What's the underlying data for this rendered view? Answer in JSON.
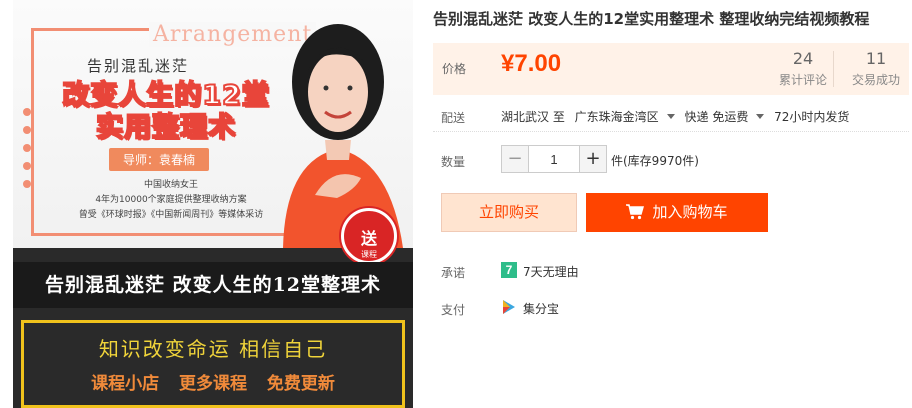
{
  "product_image": {
    "watermark": "Arrangement",
    "chaos_line": "告别混乱迷茫",
    "headline_1": "改变人生的12堂",
    "headline_2": "实用整理术",
    "teacher": "导师：袁春楠",
    "tag_1": "中国收纳女王",
    "tag_2": "4年为10000个家庭提供整理收纳方案",
    "tag_3": "曾受《环球时报》《中国新闻周刊》等媒体采访",
    "gift_main": "送",
    "gift_sub": "课程",
    "banner": "告别混乱迷茫  改变人生的12堂整理术",
    "slogan": "知识改变命运   相信自己",
    "tags": [
      "课程小店",
      "更多课程",
      "免费更新"
    ]
  },
  "product": {
    "title": "告别混乱迷茫 改变人生的12堂实用整理术 整理收纳完结视频教程",
    "price_label": "价格",
    "price": "¥7.00",
    "reviews_count": "24",
    "reviews_label": "累计评论",
    "sales_count": "11",
    "sales_label": "交易成功"
  },
  "shipping": {
    "label": "配送",
    "from": "湖北武汉 至",
    "to": "广东珠海金湾区",
    "method": "快递 免运费",
    "time": "72小时内发货"
  },
  "quantity": {
    "label": "数量",
    "minus": "−",
    "value": "1",
    "plus": "+",
    "stock": "件(库存9970件)"
  },
  "actions": {
    "buy_now": "立即购买",
    "add_to_cart": "加入购物车"
  },
  "promise": {
    "label": "承诺",
    "icon_text": "7",
    "text": "7天无理由"
  },
  "payment": {
    "label": "支付",
    "text": "集分宝"
  },
  "colors": {
    "accent": "#ff4400",
    "price_bg": "#fff2e8",
    "promise": "#2ebd8a"
  }
}
